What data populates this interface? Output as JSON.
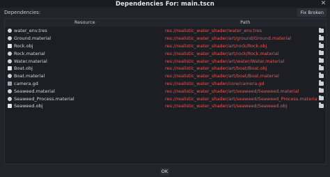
{
  "window": {
    "title": "Dependencies For: main.tscn",
    "close_glyph": "✕"
  },
  "dependencies_label": "Dependencies:",
  "fix_broken_label": "Fix Broken",
  "table": {
    "headers": {
      "resource": "Resource",
      "path": "Path"
    },
    "rows": [
      {
        "icon": "resource-icon",
        "name": "water_env.tres",
        "path": "res://realistic_water_shader/water_env.tres"
      },
      {
        "icon": "material-icon",
        "name": "Ground.material",
        "path": "res://realistic_water_shader/art/ground/Ground.material"
      },
      {
        "icon": "mesh-icon",
        "name": "Rock.obj",
        "path": "res://realistic_water_shader/art/rock/Rock.obj"
      },
      {
        "icon": "material-icon",
        "name": "Rock.material",
        "path": "res://realistic_water_shader/art/rock/Rock.material"
      },
      {
        "icon": "material-icon",
        "name": "Water.material",
        "path": "res://realistic_water_shader/art/water/Water.material"
      },
      {
        "icon": "mesh-icon",
        "name": "Boat.obj",
        "path": "res://realistic_water_shader/art/boat/Boat.obj"
      },
      {
        "icon": "material-icon",
        "name": "Boat.material",
        "path": "res://realistic_water_shader/art/boat/Boat.material"
      },
      {
        "icon": "script-icon",
        "name": "camera.gd",
        "path": "res://realistic_water_shader/core/camera.gd"
      },
      {
        "icon": "material-icon",
        "name": "Seaweed.material",
        "path": "res://realistic_water_shader/art/seaweed/Seaweed.material"
      },
      {
        "icon": "material-icon",
        "name": "Seaweed_Process.material",
        "path": "res://realistic_water_shader/art/seaweed/Seaweed_Process.material"
      },
      {
        "icon": "mesh-icon",
        "name": "Seaweed.obj",
        "path": "res://realistic_water_shader/art/seaweed/Seaweed.obj"
      }
    ]
  },
  "ok_label": "OK",
  "colors": {
    "broken_path": "#e05a55",
    "background": "#21242a"
  }
}
